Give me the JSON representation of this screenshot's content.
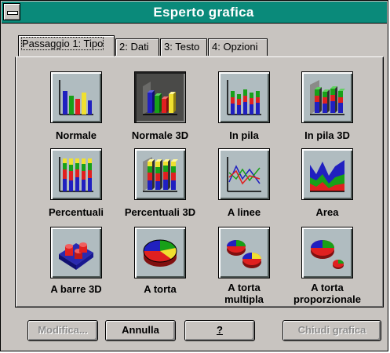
{
  "window": {
    "title": "Esperto grafica"
  },
  "tabs": [
    {
      "label": "Passaggio 1: Tipo",
      "active": true
    },
    {
      "label": "2: Dati",
      "active": false
    },
    {
      "label": "3: Testo",
      "active": false
    },
    {
      "label": "4: Opzioni",
      "active": false
    }
  ],
  "chart_types": [
    {
      "label": "Normale",
      "icon": "bar-chart-icon",
      "selected": false
    },
    {
      "label": "Normale 3D",
      "icon": "bar-chart-3d-icon",
      "selected": true
    },
    {
      "label": "In pila",
      "icon": "stacked-bar-icon",
      "selected": false
    },
    {
      "label": "In pila 3D",
      "icon": "stacked-bar-3d-icon",
      "selected": false
    },
    {
      "label": "Percentuali",
      "icon": "percent-bar-icon",
      "selected": false
    },
    {
      "label": "Percentuali 3D",
      "icon": "percent-bar-3d-icon",
      "selected": false
    },
    {
      "label": "A linee",
      "icon": "line-chart-icon",
      "selected": false
    },
    {
      "label": "Area",
      "icon": "area-chart-icon",
      "selected": false
    },
    {
      "label": "A barre 3D",
      "icon": "bar-3d-surface-icon",
      "selected": false
    },
    {
      "label": "A torta",
      "icon": "pie-chart-icon",
      "selected": false
    },
    {
      "label": "A torta multipla",
      "label_line1": "A torta",
      "label_line2": "multipla",
      "icon": "multi-pie-icon",
      "selected": false
    },
    {
      "label": "A torta proporzionale",
      "label_line1": "A torta",
      "label_line2": "proporzionale",
      "icon": "proportional-pie-icon",
      "selected": false
    }
  ],
  "buttons": {
    "modifica": "Modifica...",
    "annulla": "Annulla",
    "help": "?",
    "chiudi": "Chiudi grafica"
  },
  "colors": {
    "titlebar": "#0a8a7a",
    "face": "#c8c4c0",
    "icon_bg": "#b0bcc0",
    "red": "#e02020",
    "green": "#18a018",
    "blue": "#2020c0",
    "yellow": "#f0e030"
  }
}
